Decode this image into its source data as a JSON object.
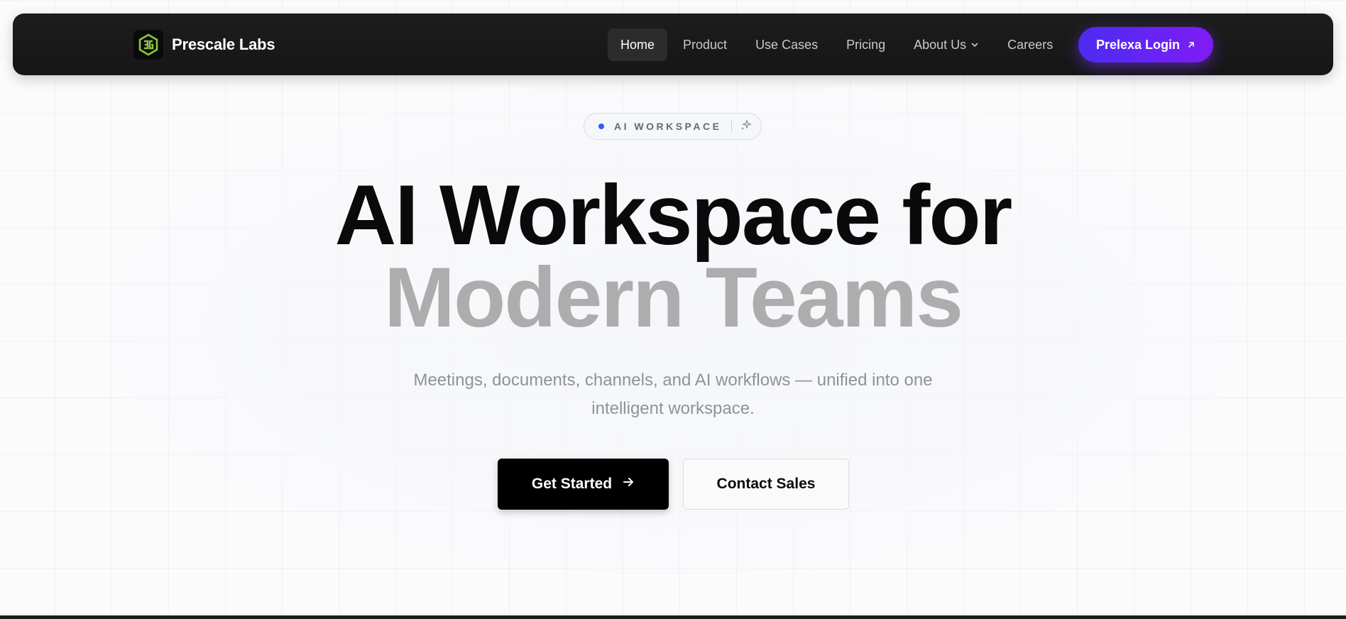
{
  "navbar": {
    "brand_name": "Prescale Labs",
    "brand_icon": "prescale-logo-icon",
    "links": [
      {
        "label": "Home",
        "active": true
      },
      {
        "label": "Product"
      },
      {
        "label": "Use Cases"
      },
      {
        "label": "Pricing"
      },
      {
        "label": "About Us",
        "has_dropdown": true,
        "icon": "chevron-down-icon"
      },
      {
        "label": "Careers"
      }
    ],
    "login_label": "Prelexa Login",
    "login_icon": "arrow-up-right-icon"
  },
  "badge": {
    "text": "AI WORKSPACE",
    "icon": "sparkle-icon"
  },
  "hero": {
    "title_line1": "AI Workspace for",
    "title_line2": "Modern Teams",
    "subtitle": "Meetings, documents, channels, and AI workflows — unified into one intelligent workspace."
  },
  "cta": {
    "primary_label": "Get Started",
    "primary_icon": "arrow-right-icon",
    "secondary_label": "Contact Sales"
  },
  "colors": {
    "accent_start": "#4b2cf2",
    "accent_end": "#7f1cf5",
    "badge_dot": "#2f5bff",
    "logo_green": "#8cc63f"
  }
}
